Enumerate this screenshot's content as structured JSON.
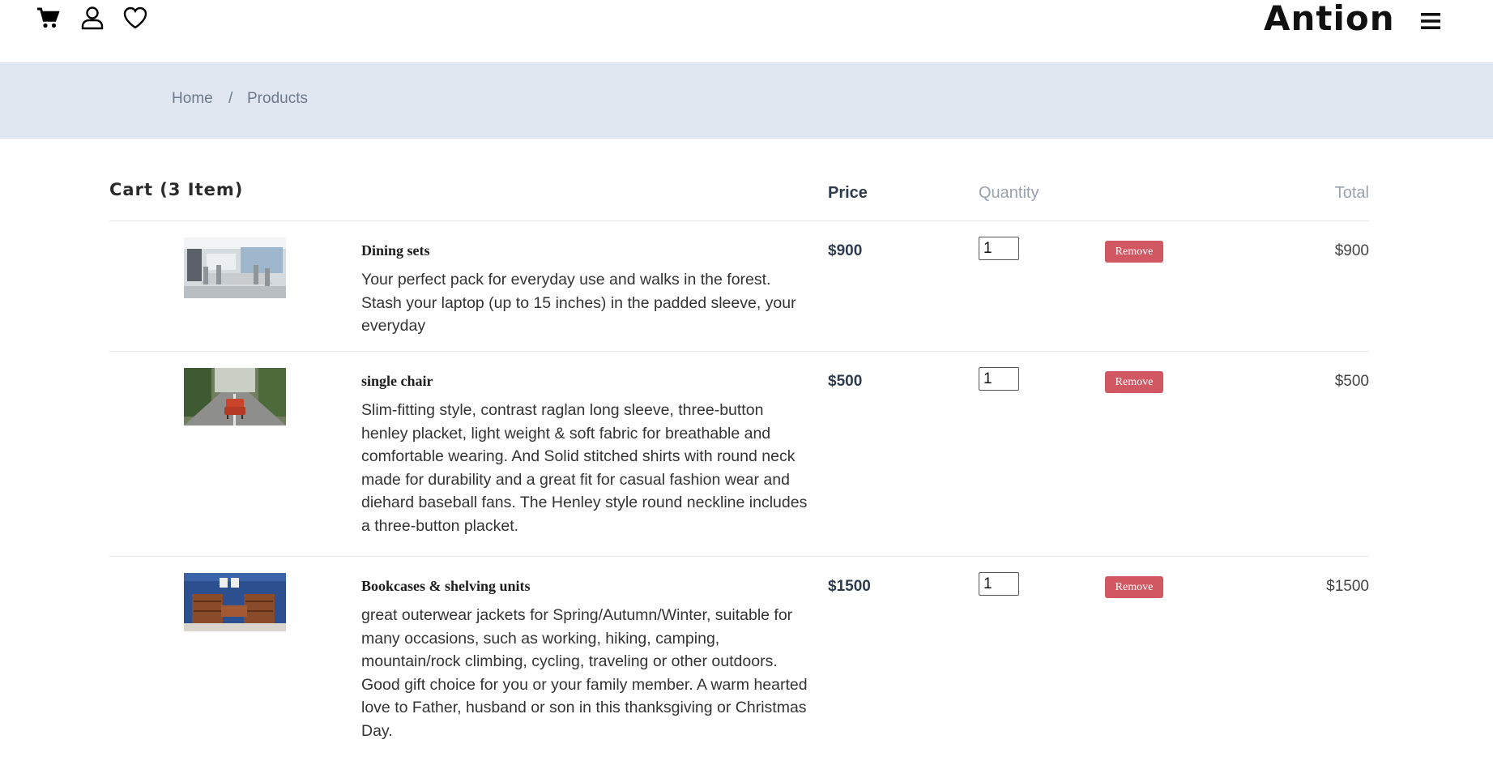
{
  "header": {
    "brand": "Antion",
    "icons": [
      "cart-icon",
      "user-icon",
      "heart-icon",
      "menu-icon"
    ]
  },
  "breadcrumb": {
    "home": "Home",
    "separator": "/",
    "current": "Products"
  },
  "cart": {
    "title": "Cart (3 Item)",
    "columns": {
      "price": "Price",
      "quantity": "Quantity",
      "total": "Total"
    },
    "items": [
      {
        "name": "Dining sets",
        "description": "Your perfect pack for everyday use and walks in the forest. Stash your laptop (up to 15 inches) in the padded sleeve, your everyday",
        "price": "$900",
        "quantity": "1",
        "remove_label": "Remove",
        "total": "$900"
      },
      {
        "name": "single chair",
        "description": "Slim-fitting style, contrast raglan long sleeve, three-button henley placket, light weight & soft fabric for breathable and comfortable wearing. And Solid stitched shirts with round neck made for durability and a great fit for casual fashion wear and diehard baseball fans. The Henley style round neckline includes a three-button placket.",
        "price": "$500",
        "quantity": "1",
        "remove_label": "Remove",
        "total": "$500"
      },
      {
        "name": "Bookcases & shelving units",
        "description": "great outerwear jackets for Spring/Autumn/Winter, suitable for many occasions, such as working, hiking, camping, mountain/rock climbing, cycling, traveling or other outdoors. Good gift choice for you or your family member. A warm hearted love to Father, husband or son in this thanksgiving or Christmas Day.",
        "price": "$1500",
        "quantity": "1",
        "remove_label": "Remove",
        "total": "$1500"
      }
    ]
  },
  "colors": {
    "breadcrumb_bg": "#e1e7f0",
    "remove_button": "#d15862",
    "price_text": "#2e3b4e"
  }
}
